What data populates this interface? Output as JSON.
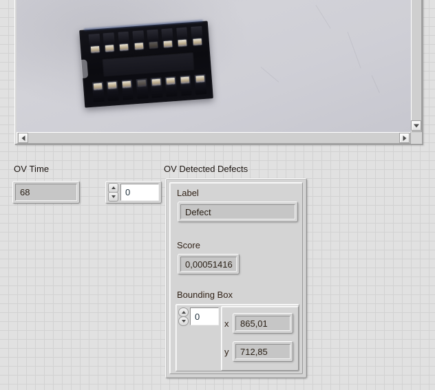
{
  "image_display": {
    "name": "image-display",
    "photo_subject": "16-pin DIP IC socket on light gray background",
    "hscroll": {
      "left_arrow": "◀",
      "right_arrow": "▶"
    },
    "vscroll": {
      "down_arrow": "▼"
    }
  },
  "ov_time": {
    "label": "OV Time",
    "value": "68"
  },
  "index_control": {
    "value": "0",
    "up_arrow": "▲",
    "down_arrow": "▼"
  },
  "detected_defects": {
    "label": "OV Detected Defects",
    "fields": {
      "label_caption": "Label",
      "label_value": "Defect",
      "score_caption": "Score",
      "score_value": "0,00051416",
      "bbox_caption": "Bounding Box"
    },
    "bbox_index": {
      "value": "0",
      "up_arrow": "▲",
      "down_arrow": "▼"
    },
    "bbox_items": [
      {
        "axis": "x",
        "value": "865,01"
      },
      {
        "axis": "y",
        "value": "712,85"
      }
    ]
  },
  "colors": {
    "panel_background": "#e1e1e1",
    "grid_line": "#d2d2d2",
    "control_face": "#d4d4d4",
    "indicator_field": "#c6c6c6",
    "label_text": "#1b1410",
    "value_text": "#2a2016"
  }
}
